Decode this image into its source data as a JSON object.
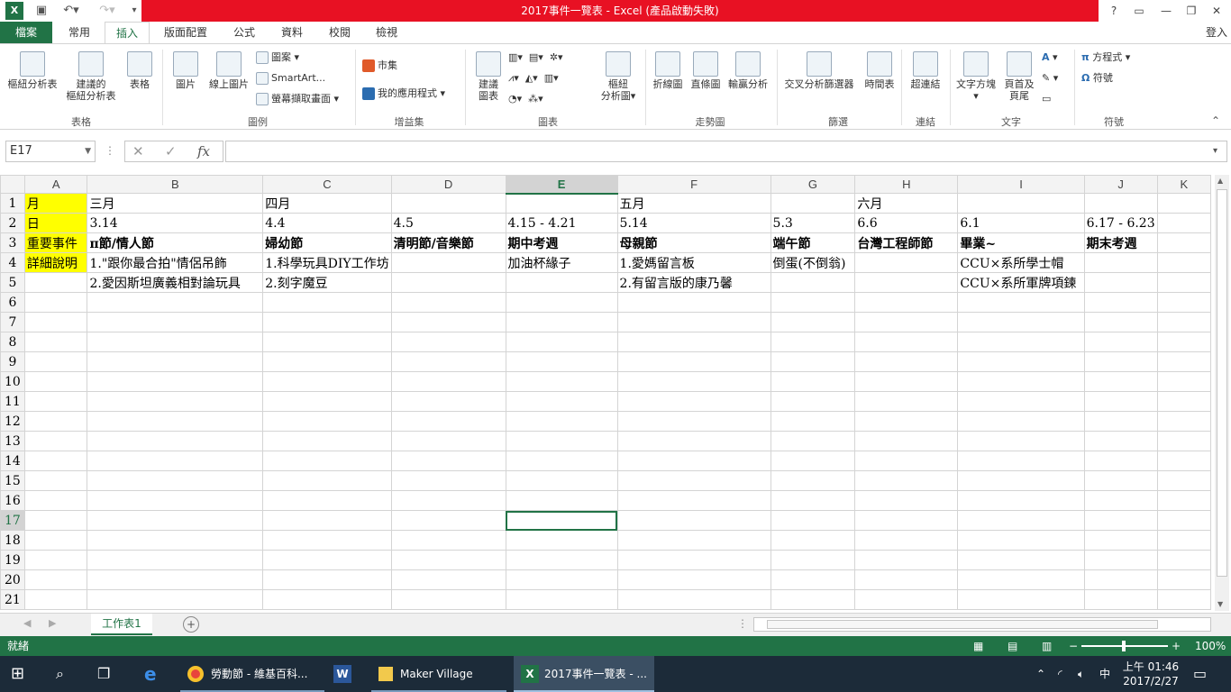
{
  "window": {
    "title": "2017事件一覽表 - Excel (產品啟動失敗)",
    "help": "?",
    "signin": "登入"
  },
  "tabs": [
    "檔案",
    "常用",
    "插入",
    "版面配置",
    "公式",
    "資料",
    "校閱",
    "檢視"
  ],
  "ribbon": {
    "pivot": "樞紐分析表",
    "rec_pivot_1": "建議的",
    "rec_pivot_2": "樞紐分析表",
    "table": "表格",
    "grp_tables": "表格",
    "pictures": "圖片",
    "online_pictures": "線上圖片",
    "shapes": "圖案",
    "smartart": "SmartArt...",
    "screenshot": "螢幕擷取畫面",
    "grp_illus": "圖例",
    "store": "市集",
    "my_addins": "我的應用程式",
    "grp_addins": "增益集",
    "rec_charts_1": "建議",
    "rec_charts_2": "圖表",
    "pivot_chart_1": "樞紐",
    "pivot_chart_2": "分析圖",
    "grp_charts": "圖表",
    "line": "折線圖",
    "column": "直條圖",
    "winloss": "輸贏分析",
    "grp_spark": "走勢圖",
    "slicer": "交叉分析篩選器",
    "timeline": "時間表",
    "grp_filter": "篩選",
    "hyperlink": "超連結",
    "grp_links": "連結",
    "textbox": "文字方塊",
    "header_1": "頁首及",
    "header_2": "頁尾",
    "grp_text": "文字",
    "equation": "方程式",
    "symbol": "符號",
    "grp_symbols": "符號"
  },
  "formula_bar": {
    "namebox": "E17",
    "fx": "fx",
    "value": ""
  },
  "columns": [
    "A",
    "B",
    "C",
    "D",
    "E",
    "F",
    "G",
    "H",
    "I",
    "J",
    "K"
  ],
  "rows": [
    [
      "月",
      "三月",
      "四月",
      "",
      "",
      "五月",
      "",
      "六月",
      "",
      "",
      ""
    ],
    [
      "日",
      "3.14",
      "4.4",
      "4.5",
      "4.15 - 4.21",
      "5.14",
      "5.3",
      "6.6",
      "6.1",
      "6.17 - 6.23",
      ""
    ],
    [
      "重要事件",
      "π節/情人節",
      "婦幼節",
      "清明節/音樂節",
      "期中考週",
      "母親節",
      "端午節",
      "台灣工程師節",
      "畢業~",
      "期末考週",
      ""
    ],
    [
      "詳細說明",
      "1.\"跟你最合拍\"情侶吊飾",
      "1.科學玩具DIY工作坊",
      "",
      "加油杯緣子",
      "1.愛媽留言板",
      "倒蛋(不倒翁)",
      "",
      "CCU×系所學士帽",
      "",
      ""
    ],
    [
      "",
      "2.愛因斯坦廣義相對論玩具",
      "2.刻字魔豆",
      "",
      "",
      "2.有留言版的康乃馨",
      "",
      "",
      "CCU×系所軍牌項鍊",
      "",
      ""
    ]
  ],
  "row_numbers": [
    "1",
    "2",
    "3",
    "4",
    "5",
    "6",
    "7",
    "8",
    "9",
    "10",
    "11",
    "12",
    "13",
    "14",
    "15",
    "16",
    "17",
    "18",
    "19",
    "20",
    "21"
  ],
  "sheet_tab": "工作表1",
  "status": {
    "ready": "就緒",
    "zoom": "100%"
  },
  "taskbar": {
    "chrome": "勞動節 - 維基百科...",
    "folder": "Maker Village",
    "excel": "2017事件一覽表 - ...",
    "time": "上午 01:46",
    "date": "2017/2/27",
    "ime": "中"
  }
}
